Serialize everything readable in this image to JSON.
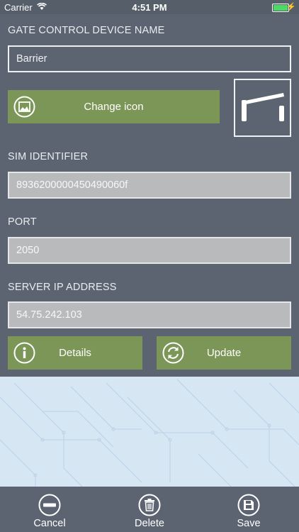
{
  "status_bar": {
    "carrier": "Carrier",
    "time": "4:51 PM"
  },
  "form": {
    "device_name_label": "GATE CONTROL DEVICE NAME",
    "device_name_value": "Barrier",
    "change_icon_label": "Change icon",
    "sim_label": "SIM IDENTIFIER",
    "sim_value": "8936200000450490060f",
    "port_label": "PORT",
    "port_value": "2050",
    "ip_label": "SERVER IP ADDRESS",
    "ip_value": "54.75.242.103",
    "details_label": "Details",
    "update_label": "Update"
  },
  "tabbar": {
    "cancel_label": "Cancel",
    "delete_label": "Delete",
    "save_label": "Save"
  },
  "colors": {
    "panel": "#5b6470",
    "button_green": "#7b9656",
    "background": "#d6e6f3"
  },
  "icons": {
    "change_icon": "image-icon",
    "device_icon": "barrier-gate-icon",
    "details": "info-icon",
    "update": "refresh-icon",
    "cancel": "minus-circle-icon",
    "delete": "trash-icon",
    "save": "save-icon"
  }
}
